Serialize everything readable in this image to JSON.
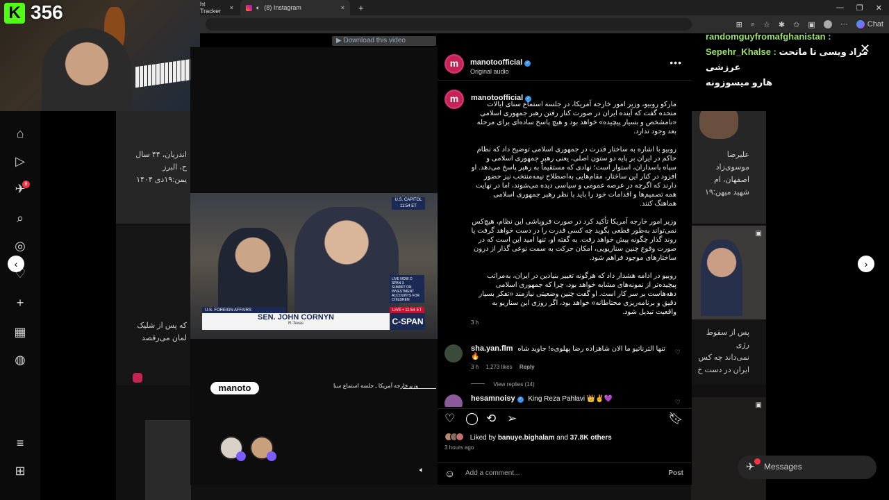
{
  "stream": {
    "kick_count": "356",
    "kick_logo": "K"
  },
  "browser": {
    "tabs": [
      {
        "label": "ht Tracker"
      },
      {
        "label": "(8) Instagram"
      }
    ],
    "chat_button": "Chat"
  },
  "chat_messages": [
    {
      "user": "randomguyfromafghanistan :",
      "text": ""
    },
    {
      "user": "Sepehr_Khalse :",
      "text": "مراد ویسی تا ماتحت عرزشی"
    },
    {
      "user": "",
      "text": "هارو میسوزونه"
    }
  ],
  "download_bar": "Download this video",
  "video": {
    "us_capitol": "U.S. CAPITOL",
    "capitol_time": "11:54 ET",
    "live_now": "LIVE NOW C-SPAN 3",
    "live_box_text": "SUMMIT ON INVESTMENT ACCOUNTS FOR CHILDREN",
    "live_label": "LIVE • 11:54 ET",
    "affairs": "U.S. FOREIGN AFFAIRS",
    "senator": "SEN. JOHN CORNYN",
    "senator_party": "R-Texas",
    "network": "C-SPAN",
    "brand": "manoto",
    "caption": "وزیرخارجه آمریکا ـ جلسه استماع سنا"
  },
  "post": {
    "username": "manotoofficial",
    "audio": "Original audio",
    "caption_username": "manotoofficial",
    "paragraphs": [
      "مارکو روبیو، وزیر امور خارجه آمریکا، در جلسه استماع سنای ایالات متحده گفت که آینده ایران در صورت کنار رفتن رهبر جمهوری اسلامی «نامشخص و بسیار پیچیده» خواهد بود و هیچ پاسخ ساده‌ای برای مرحله بعد وجود ندارد.",
      "روبیو با اشاره به ساختار قدرت در جمهوری اسلامی توضیح داد که نظام حاکم در ایران بر پایه دو ستون اصلی، یعنی رهبر جمهوری اسلامی و سپاه پاسداران، استوار است؛ نهادی که مستقیماً به رهبر پاسخ می‌دهد. او افزود در کنار این ساختار، مقام‌هایی به‌اصطلاح نیمه‌منتخب نیز حضور دارند که اگرچه در عرصه عمومی و سیاسی دیده می‌شوند، اما در نهایت همه تصمیم‌ها و اقدامات خود را باید با نظر رهبر جمهوری اسلامی هماهنگ کنند.",
      "وزیر امور خارجه آمریکا تأکید کرد در صورت فروپاشی این نظام، هیچ‌کس نمی‌تواند به‌طور قطعی بگوید چه کسی قدرت را در دست خواهد گرفت یا روند گذار چگونه پیش خواهد رفت. به گفته او، تنها امید این است که در صورت وقوع چنین سناریویی، امکان حرکت به سمت نوعی گذار از درون ساختارهای موجود فراهم شود.",
      "روبیو در ادامه هشدار داد که هرگونه تغییر بنیادین در ایران، به‌مراتب پیچیده‌تر از نمونه‌های مشابه خواهد بود، چرا که جمهوری اسلامی دهه‌هاست بر سر کار است. او گفت چنین وضعیتی نیازمند «تفکر بسیار دقیق و برنامه‌ریزی محتاطانه» خواهد بود، اگر روزی این سناریو به واقعیت تبدیل شود."
    ],
    "caption_time": "3 h",
    "comments": [
      {
        "username": "sha.yan.flm",
        "text": "تنها الترناتیو ما الان شاهزاده رضا پهلوی‌ه! جاوید شاه 🔥",
        "time": "3 h",
        "likes": "1,273 likes",
        "reply": "Reply",
        "view_replies": "View replies (14)"
      },
      {
        "username": "hesamnoisy",
        "text": "King Reza Pahlavi 👑✌️💜"
      }
    ],
    "liked_by_prefix": "Liked by",
    "liked_by_user": "banuye.bighalam",
    "liked_by_and": "and",
    "liked_by_others": "37.8K others",
    "time_ago": "3 hours ago",
    "add_comment_placeholder": "Add a comment...",
    "post_button": "Post"
  },
  "background_grid": {
    "left_texts": [
      "اندریان، ۴۴ سال",
      "ح، البرز",
      "یمن:۱۹دی ۱۴۰۴"
    ],
    "right_texts": [
      "علیرضا موسوی‌زاد",
      "اصفهان، ام",
      "شهید میهن:۱۹"
    ],
    "lower_left": [
      "که پس از شلیک",
      "لمان می‌رقصد"
    ],
    "lower_right": [
      "پس از سقوط رژی",
      "نمی‌داند چه کس",
      "ایران در دست خ"
    ]
  },
  "messages_pill": {
    "label": "Messages",
    "badge": "8"
  },
  "nav_badge": "8",
  "colors": {
    "accent": "#3897f0",
    "kick": "#53fc18",
    "brand": "#c42452"
  }
}
